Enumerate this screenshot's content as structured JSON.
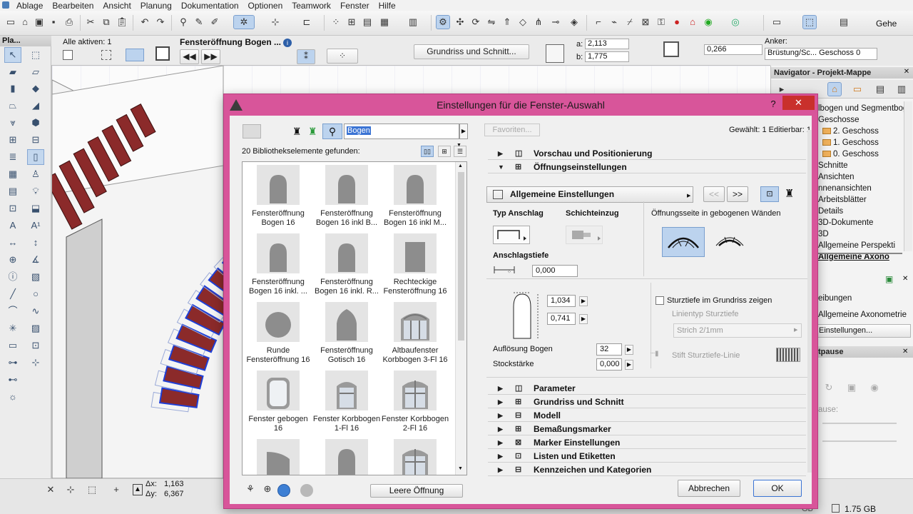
{
  "menu": [
    "Ablage",
    "Bearbeiten",
    "Ansicht",
    "Planung",
    "Dokumentation",
    "Optionen",
    "Teamwork",
    "Fenster",
    "Hilfe"
  ],
  "toolbar": {
    "right_label": "Gehe"
  },
  "infobox": {
    "all_active": "Alle aktiven: 1",
    "element_name": "Fensteröffnung Bogen ...",
    "grundriss_button": "Grundriss und Schnitt...",
    "a_label": "a:",
    "a_value": "2,113",
    "b_label": "b:",
    "b_value": "1,775",
    "offset_value": "0,266",
    "anchor_label": "Anker:",
    "anchor_value": "Brüstung/Sc... Geschoss 0"
  },
  "navigator": {
    "title": "Navigator - Projekt-Mappe",
    "items": [
      {
        "label": "lbogen und Segmentbog",
        "folder": false
      },
      {
        "label": "Geschosse",
        "folder": false
      },
      {
        "label": "2. Geschoss",
        "folder": true
      },
      {
        "label": "1. Geschoss",
        "folder": true
      },
      {
        "label": "0. Geschoss",
        "folder": true
      },
      {
        "label": "Schnitte",
        "folder": false
      },
      {
        "label": "Ansichten",
        "folder": false
      },
      {
        "label": "nnenansichten",
        "folder": false
      },
      {
        "label": "Arbeitsblätter",
        "folder": false
      },
      {
        "label": "Details",
        "folder": false
      },
      {
        "label": "3D-Dokumente",
        "folder": false
      },
      {
        "label": "3D",
        "folder": false
      },
      {
        "label": "Allgemeine Perspekti",
        "folder": false
      },
      {
        "label": "Allgemeine Axono",
        "folder": false
      }
    ],
    "props": {
      "row1": "eibungen",
      "row2": "Allgemeine Axonometrie",
      "row3": "Einstellungen..."
    },
    "pause_title": "tpause",
    "pause_label": "ause:"
  },
  "coords": {
    "dx_label": "Δx:",
    "dx": "1,163",
    "dy_label": "Δy:",
    "dy": "6,367"
  },
  "status": {
    "size": "1.75 GB",
    "extra": "GB"
  },
  "dialog": {
    "title": "Einstellungen für die Fenster-Auswahl",
    "help": "?",
    "close": "✕",
    "search_value": "Bogen",
    "found_text": "20 Bibliothekselemente gefunden:",
    "favorites": "Favoriten...",
    "selected_info": "Gewählt: 1 Editierbar: 1",
    "library_items": [
      {
        "label": "Fensteröffnung Bogen 16",
        "shape": "arch"
      },
      {
        "label": "Fensteröffnung Bogen 16 inkl B...",
        "shape": "arch"
      },
      {
        "label": "Fensteröffnung Bogen 16 inkl M...",
        "shape": "arch"
      },
      {
        "label": "Fensteröffnung Bogen 16 inkl. ...",
        "shape": "arch"
      },
      {
        "label": "Fensteröffnung Bogen 16 inkl. R...",
        "shape": "arch"
      },
      {
        "label": "Rechteckige Fensteröffnung 16",
        "shape": "rect"
      },
      {
        "label": "Runde Fensteröffnung 16",
        "shape": "circle"
      },
      {
        "label": "Fensteröffnung Gotisch 16",
        "shape": "gothic"
      },
      {
        "label": "Altbaufenster Korbbogen 3-Fl 16",
        "shape": "window3"
      },
      {
        "label": "Fenster gebogen 16",
        "shape": "bent"
      },
      {
        "label": "Fenster Korbbogen 1-Fl 16",
        "shape": "window1"
      },
      {
        "label": "Fenster Korbbogen 2-Fl 16",
        "shape": "window2"
      },
      {
        "label": "",
        "shape": "quarter"
      },
      {
        "label": "",
        "shape": "arch"
      },
      {
        "label": "",
        "shape": "window2"
      }
    ],
    "empty_opening_button": "Leere Öffnung",
    "sections_top": [
      {
        "label": "Vorschau und Positionierung",
        "expanded": false
      },
      {
        "label": "Öffnungseinstellungen",
        "expanded": true
      }
    ],
    "general_settings": "Allgemeine Einstellungen",
    "nav_prev": "<<",
    "nav_next": ">>",
    "typ_anschlag": "Typ Anschlag",
    "schichteinzug": "Schichteinzug",
    "oeffnungsseite": "Öffnungsseite in gebogenen Wänden",
    "anschlagstiefe": "Anschlagstiefe",
    "anschlagstiefe_value": "0,000",
    "height_value": "1,034",
    "width_value": "0,741",
    "sturztiefe_checkbox": "Sturztiefe im Grundriss zeigen",
    "linientyp": "Linientyp Sturztiefe",
    "strich": "Strich 2/1mm",
    "stift": "Stift Sturztiefe-Linie",
    "aufloesung_label": "Auflösung Bogen",
    "aufloesung_value": "32",
    "stockstaerke_label": "Stockstärke",
    "stockstaerke_value": "0,000",
    "sections_bottom": [
      {
        "label": "Parameter"
      },
      {
        "label": "Grundriss und Schnitt"
      },
      {
        "label": "Modell"
      },
      {
        "label": "Bemaßungsmarker"
      },
      {
        "label": "Marker Einstellungen"
      },
      {
        "label": "Listen und Etiketten"
      },
      {
        "label": "Kennzeichen und Kategorien"
      }
    ],
    "cancel": "Abbrechen",
    "ok": "OK"
  },
  "colors": {
    "dialog_frame": "#d8559a",
    "brick": "#8b2a2a",
    "selection": "#1f3fd6",
    "accent": "#2a6fd6"
  }
}
